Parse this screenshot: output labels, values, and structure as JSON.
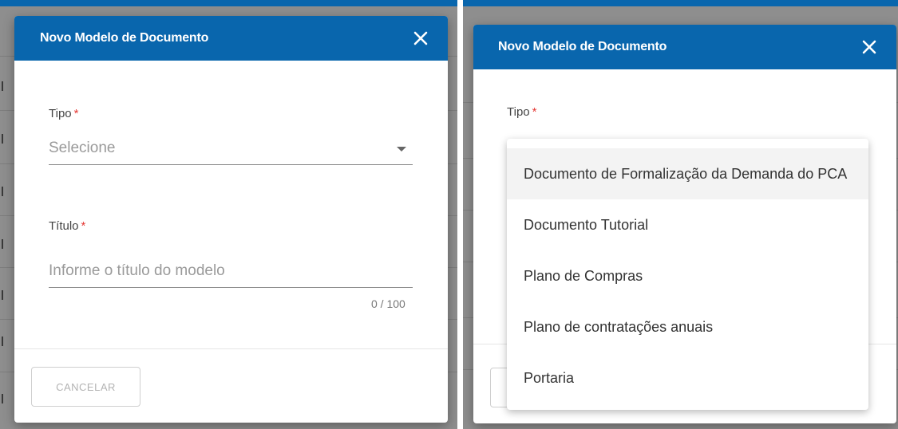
{
  "dialog": {
    "title": "Novo Modelo de Documento"
  },
  "form": {
    "tipo_label": "Tipo",
    "tipo_placeholder": "Selecione",
    "titulo_label": "Título",
    "titulo_placeholder": "Informe o título do modelo",
    "titulo_counter": "0 / 100",
    "required_marker": "*"
  },
  "footer": {
    "cancel_label": "CANCELAR"
  },
  "dropdown": {
    "options": [
      "Documento de Formalização da Demanda do PCA",
      "Documento Tutorial",
      "Plano de Compras",
      "Plano de contratações anuais",
      "Portaria"
    ]
  },
  "colors": {
    "header": "#0966ad",
    "required": "#e53935"
  },
  "icons": {
    "close": "close-icon",
    "dropdown": "chevron-down-icon"
  }
}
